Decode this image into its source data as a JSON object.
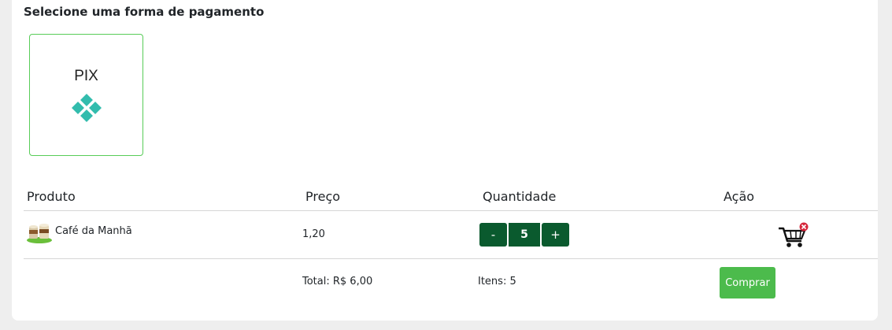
{
  "payment": {
    "title": "Selecione uma forma de pagamento",
    "option_label": "PIX",
    "accent_color": "#32bcad",
    "border_color": "#58cc58"
  },
  "table": {
    "headers": {
      "product": "Produto",
      "price": "Preço",
      "quantity": "Quantidade",
      "action": "Ação"
    },
    "rows": [
      {
        "product": "Café da Manhã",
        "price": "1,20",
        "quantity": "5",
        "minus": "-",
        "plus": "+"
      }
    ],
    "footer": {
      "total": "Total: R$ 6,00",
      "items": "Itens: 5",
      "buy_label": "Comprar"
    }
  },
  "icons": {
    "pix": "pix-logo-icon",
    "product": "coffee-cups-icon",
    "remove": "cart-remove-icon"
  }
}
